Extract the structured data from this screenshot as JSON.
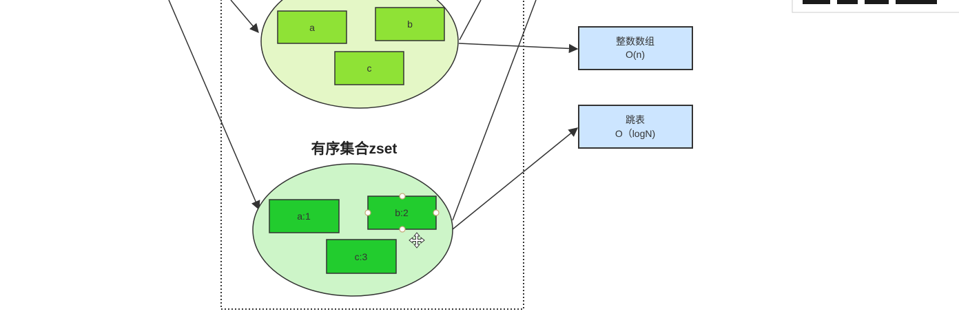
{
  "colors": {
    "set_ellipse_fill": "#e4f7c6",
    "zset_ellipse_fill": "#cdf5c8",
    "green_box_light": "#8fe236",
    "green_box": "#22cc2e",
    "blue_box": "#cce5ff",
    "stroke": "#333333"
  },
  "set_items": [
    "a",
    "b",
    "c"
  ],
  "zset": {
    "title": "有序集合zset",
    "items": [
      "a:1",
      "b:2",
      "c:3"
    ]
  },
  "encodings": [
    {
      "name": "整数数组",
      "complexity": "O(n)"
    },
    {
      "name": "跳表",
      "complexity": "O（logN)"
    }
  ],
  "cursor_icon": "move-cursor-icon",
  "selection_handles_on": "b:2"
}
